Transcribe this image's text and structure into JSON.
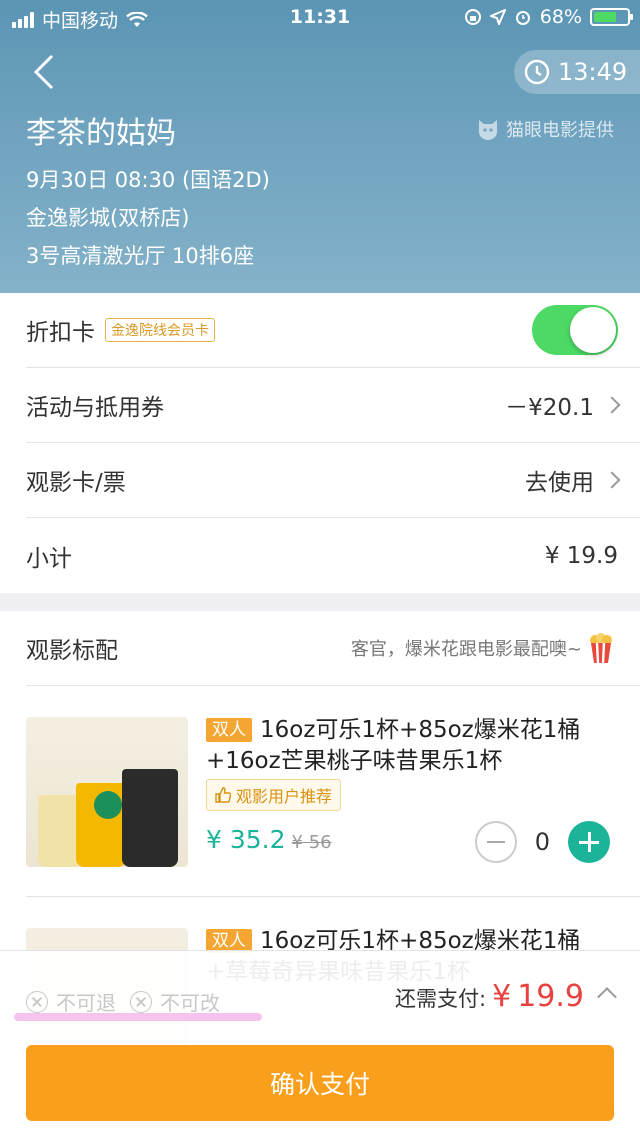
{
  "status_bar": {
    "carrier": "中国移动",
    "time": "11:31",
    "battery": "68%",
    "battery_level": 0.68
  },
  "header": {
    "countdown": "13:49",
    "movie_title": "李茶的姑妈",
    "provider": "猫眼电影提供",
    "showtime": "9月30日 08:30 (国语2D)",
    "cinema": "金逸影城(双桥店)",
    "hall_seat": "3号高清激光厅 10排6座"
  },
  "options": {
    "discount_card": {
      "label": "折扣卡",
      "tag": "金逸院线会员卡",
      "enabled": true
    },
    "coupons": {
      "label": "活动与抵用券",
      "value": "－¥20.1"
    },
    "movie_card": {
      "label": "观影卡/票",
      "value": "去使用"
    },
    "subtotal": {
      "label": "小计",
      "value": "¥ 19.9"
    }
  },
  "combo": {
    "header": "观影标配",
    "hint": "客官，爆米花跟电影最配噢~",
    "items": [
      {
        "badge": "双人",
        "title": "16oz可乐1杯+85oz爆米花1桶+16oz芒果桃子味昔果乐1杯",
        "recommend": "观影用户推荐",
        "price": "¥ 35.2",
        "old_price": "¥ 56",
        "quantity": "0"
      },
      {
        "badge": "双人",
        "title": "16oz可乐1杯+85oz爆米花1桶+草莓奇异果味昔果乐1杯"
      }
    ]
  },
  "bottom": {
    "no_refund": "不可退",
    "no_change": "不可改",
    "need_pay_label": "还需支付:",
    "need_pay_currency": "¥",
    "need_pay_amount": "19.9",
    "pay_button": "确认支付"
  },
  "colors": {
    "accent_teal": "#1cb39b",
    "pay_orange": "#fa9f1b",
    "price_red": "#e8423f",
    "toggle_green": "#4cd964"
  }
}
